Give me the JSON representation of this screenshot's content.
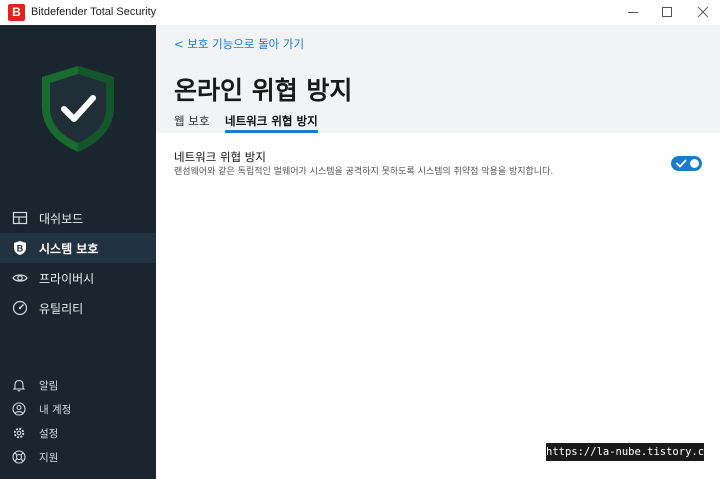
{
  "window": {
    "title": "Bitdefender Total Security",
    "logo_letter": "B"
  },
  "sidebar": {
    "nav": [
      {
        "label": "대쉬보드",
        "icon": "dashboard-icon",
        "active": false
      },
      {
        "label": "시스템 보호",
        "icon": "bitdefender-b-icon",
        "active": true
      },
      {
        "label": "프라이버시",
        "icon": "eye-icon",
        "active": false
      },
      {
        "label": "유틸리티",
        "icon": "gauge-icon",
        "active": false
      }
    ],
    "utilities": [
      {
        "label": "알림",
        "icon": "bell-icon"
      },
      {
        "label": "내 계정",
        "icon": "account-icon"
      },
      {
        "label": "설정",
        "icon": "gear-icon"
      },
      {
        "label": "지원",
        "icon": "support-icon"
      }
    ]
  },
  "header": {
    "back_link": "< 보호 기능으로 돌아 가기",
    "title": "온라인 위협 방지",
    "tabs": [
      {
        "label": "웹 보호",
        "active": false
      },
      {
        "label": "네트워크 위협 방지",
        "active": true
      }
    ]
  },
  "feature": {
    "title": "네트워크 위협 방지",
    "description": "랜섬웨어와 같은 독립적인 멀웨어가 시스템을 공격하지 못하도록 시스템의 취약점 악용을 방지합니다.",
    "enabled": true
  },
  "watermark": "https://la-nube.tistory.com",
  "colors": {
    "sidebar_bg": "#19262e",
    "accent": "#1b7ccf",
    "shield_green": "#1f9e3a",
    "brand_red": "#e2231a"
  }
}
